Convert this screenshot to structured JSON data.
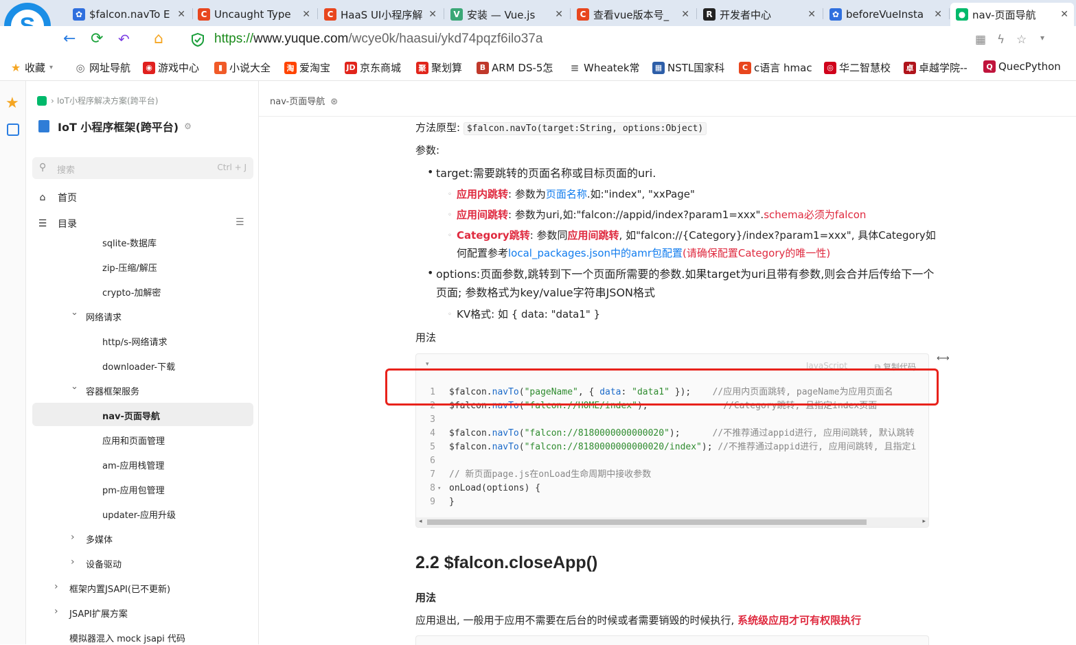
{
  "browser": {
    "tabs": [
      {
        "title": "$falcon.navTo E",
        "icon_color": "#2f6fde",
        "icon_text": "✿"
      },
      {
        "title": "Uncaught Type",
        "icon_color": "#e8461e",
        "icon_text": "C"
      },
      {
        "title": "HaaS UI小程序解",
        "icon_color": "#e8461e",
        "icon_text": "C"
      },
      {
        "title": "安装 — Vue.js",
        "icon_color": "#3aa776",
        "icon_text": "V"
      },
      {
        "title": "查看vue版本号_",
        "icon_color": "#e8461e",
        "icon_text": "C"
      },
      {
        "title": "开发者中心",
        "icon_color": "#222222",
        "icon_text": "R"
      },
      {
        "title": "beforeVueInsta",
        "icon_color": "#2f6fde",
        "icon_text": "✿"
      },
      {
        "title": "nav-页面导航",
        "icon_color": "#00b96b",
        "icon_text": "●"
      }
    ],
    "url_scheme": "https://",
    "url_host": "www.yuque.com",
    "url_path": "/wcye0k/haasui/ykd74pqzf6ilo37a",
    "bookmarks": [
      {
        "label": "收藏",
        "icon": "★",
        "color": "#f5a623"
      },
      {
        "label": "网址导航",
        "icon": "◎",
        "color": "#666666"
      },
      {
        "label": "游戏中心",
        "icon": "◉",
        "color": "#e0201e"
      },
      {
        "label": "小说大全",
        "icon": "▮",
        "color": "#f05a28"
      },
      {
        "label": "爱淘宝",
        "icon": "淘",
        "color": "#ff4400"
      },
      {
        "label": "京东商城",
        "icon": "JD",
        "color": "#e1251b"
      },
      {
        "label": "聚划算",
        "icon": "聚",
        "color": "#e1251b"
      },
      {
        "label": "ARM DS-5怎",
        "icon": "B",
        "color": "#c0392b"
      },
      {
        "label": "Wheatek常",
        "icon": "≡",
        "color": "#666666"
      },
      {
        "label": "NSTL国家科",
        "icon": "▦",
        "color": "#2d5ea8"
      },
      {
        "label": "c语言 hmac",
        "icon": "C",
        "color": "#e8461e"
      },
      {
        "label": "华二智慧校",
        "icon": "◎",
        "color": "#d0021b"
      },
      {
        "label": "卓越学院--",
        "icon": "卓",
        "color": "#b0141b"
      },
      {
        "label": "QuecPython",
        "icon": "Q",
        "color": "#c0143c"
      }
    ]
  },
  "sidebar": {
    "breadcrumb": "IoT小程序解决方案(跨平台)",
    "book_title": "IoT 小程序框架(跨平台)",
    "search_placeholder": "搜索",
    "search_shortcut": "Ctrl + J",
    "home": "首页",
    "catalog": "目录",
    "tree": [
      {
        "label": "sqlite-数据库",
        "level": 3
      },
      {
        "label": "zip-压缩/解压",
        "level": 3
      },
      {
        "label": "crypto-加解密",
        "level": 3
      },
      {
        "label": "网络请求",
        "level": 2,
        "caret": "⌄"
      },
      {
        "label": "http/s-网络请求",
        "level": 3
      },
      {
        "label": "downloader-下载",
        "level": 3
      },
      {
        "label": "容器框架服务",
        "level": 2,
        "caret": "⌄"
      },
      {
        "label": "nav-页面导航",
        "level": 3,
        "selected": true
      },
      {
        "label": "应用和页面管理",
        "level": 3
      },
      {
        "label": "am-应用栈管理",
        "level": 3
      },
      {
        "label": "pm-应用包管理",
        "level": 3
      },
      {
        "label": "updater-应用升级",
        "level": 3
      },
      {
        "label": "多媒体",
        "level": 2,
        "caret": "›"
      },
      {
        "label": "设备驱动",
        "level": 2,
        "caret": "›"
      },
      {
        "label": "框架内置JSAPI(已不更新)",
        "level": 1,
        "caret": "›"
      },
      {
        "label": "JSAPI扩展方案",
        "level": 1,
        "caret": "›"
      },
      {
        "label": "模拟器混入 mock jsapi 代码",
        "level": 1
      }
    ]
  },
  "doc": {
    "header_title": "nav-页面导航",
    "proto_label": "方法原型:",
    "proto_code": "$falcon.navTo(target:String, options:Object)",
    "params_label": "参数:",
    "target_line": "target:需要跳转的页面名称或目标页面的uri.",
    "inapp_label": "应用内跳转",
    "inapp_text1": ": 参数为",
    "inapp_link": "页面名称",
    "inapp_text2": ".如:\"index\", \"xxPage\"",
    "interapp_label": "应用间跳转",
    "interapp_text": ": 参数为uri,如:\"falcon://appid/index?param1=xxx\".",
    "interapp_red": "schema必须为falcon",
    "category_label": "Category跳转",
    "category_text1": ": 参数同",
    "category_red": "应用间跳转",
    "category_text2": ", 如\"falcon://{Category}/index?param1=xxx\", 具体Category如",
    "category_text3": "何配置参考",
    "category_link": "local_packages.json中的amr包配置",
    "category_red2": "(请确保配置Category的唯一性)",
    "options_line1": "options:页面参数,跳转到下一个页面所需要的参数.如果target为uri且带有参数,则会合并后传给下一个",
    "options_line2": "页面; 参数格式为key/value字符串JSON格式",
    "kv_line": "KV格式: 如 { data: \"data1\" }",
    "usage_label": "用法",
    "code_lang": "JavaScript",
    "code_copy": "复制代码",
    "code_lines": [
      {
        "n": "1",
        "parts": [
          [
            "$falcon.",
            ""
          ],
          [
            "navTo",
            "f"
          ],
          [
            "(",
            ""
          ],
          [
            "\"pageName\"",
            "s"
          ],
          [
            ", { ",
            ""
          ],
          [
            "data",
            "f"
          ],
          [
            ": ",
            ""
          ],
          [
            "\"data1\"",
            "s"
          ],
          [
            " });    ",
            ""
          ],
          [
            "//应用内页面跳转, pageName为应用页面名",
            "c"
          ]
        ]
      },
      {
        "n": "2",
        "parts": [
          [
            "$falcon.",
            ""
          ],
          [
            "navTo",
            "f"
          ],
          [
            "(",
            ""
          ],
          [
            "\"falcon://HOME/index\"",
            "s"
          ],
          [
            ");              ",
            ""
          ],
          [
            "//Category跳转, 且指定index页面",
            "c"
          ]
        ]
      },
      {
        "n": "3",
        "parts": []
      },
      {
        "n": "4",
        "parts": [
          [
            "$falcon.",
            ""
          ],
          [
            "navTo",
            "f"
          ],
          [
            "(",
            ""
          ],
          [
            "\"falcon://8180000000000020\"",
            "s"
          ],
          [
            ");      ",
            ""
          ],
          [
            "//不推荐通过appid进行, 应用间跳转, 默认跳转",
            "c"
          ]
        ]
      },
      {
        "n": "5",
        "parts": [
          [
            "$falcon.",
            ""
          ],
          [
            "navTo",
            "f"
          ],
          [
            "(",
            ""
          ],
          [
            "\"falcon://8180000000000020/index\"",
            "s"
          ],
          [
            "); ",
            ""
          ],
          [
            "//不推荐通过appid进行, 应用间跳转, 且指定i",
            "c"
          ]
        ]
      },
      {
        "n": "6",
        "parts": []
      },
      {
        "n": "7",
        "parts": [
          [
            "// 新页面page.js在onLoad生命周期中接收参数",
            "c"
          ]
        ]
      },
      {
        "n": "8",
        "parts": [
          [
            "onLoad(options) {",
            ""
          ]
        ],
        "fold": true
      },
      {
        "n": "9",
        "parts": [
          [
            "}",
            ""
          ]
        ]
      }
    ],
    "section_title": "2.2 $falcon.closeApp()",
    "section_usage": "用法",
    "closeapp_text": "应用退出, 一般用于应用不需要在后台的时候或者需要销毁的时候执行, ",
    "closeapp_red": "系统级应用才可有权限执行"
  },
  "colors": {
    "accent_red": "#df2a3f",
    "link": "#117cee",
    "highlight_box": "#e8221b"
  }
}
